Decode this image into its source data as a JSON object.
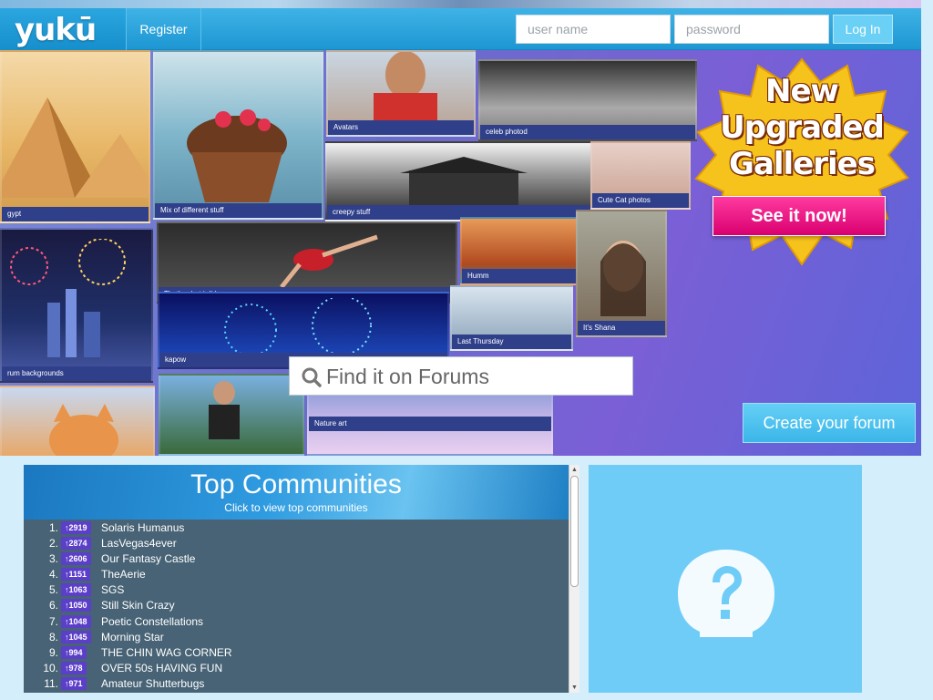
{
  "header": {
    "logo": "yukū",
    "register_label": "Register",
    "username_placeholder": "user name",
    "password_placeholder": "password",
    "login_label": "Log In"
  },
  "banner": {
    "tiles": [
      {
        "caption": "gypt"
      },
      {
        "caption": "Mix of different stuff"
      },
      {
        "caption": "Avatars"
      },
      {
        "caption": "celeb photod"
      },
      {
        "caption": "creepy stuff"
      },
      {
        "caption": "Cute Cat photos"
      },
      {
        "caption": "That's what i did"
      },
      {
        "caption": "Humm"
      },
      {
        "caption": "rum backgrounds"
      },
      {
        "caption": "kapow"
      },
      {
        "caption": "Last Thursday"
      },
      {
        "caption": "It's Shana"
      },
      {
        "caption": "Nature art"
      }
    ],
    "promo_line1": "New",
    "promo_line2": "Upgraded",
    "promo_line3": "Galleries",
    "promo_button": "See it now!",
    "search_placeholder": "Find it on Forums",
    "create_forum_label": "Create your forum"
  },
  "communities": {
    "title": "Top Communities",
    "subtitle": "Click to view top communities",
    "items": [
      {
        "rank": "1.",
        "count": "↑2919",
        "name": "Solaris Humanus"
      },
      {
        "rank": "2.",
        "count": "↑2874",
        "name": "LasVegas4ever"
      },
      {
        "rank": "3.",
        "count": "↑2606",
        "name": "Our Fantasy Castle"
      },
      {
        "rank": "4.",
        "count": "↑1151",
        "name": "TheAerie"
      },
      {
        "rank": "5.",
        "count": "↑1063",
        "name": "SGS"
      },
      {
        "rank": "6.",
        "count": "↑1050",
        "name": "Still Skin Crazy"
      },
      {
        "rank": "7.",
        "count": "↑1048",
        "name": "Poetic Constellations"
      },
      {
        "rank": "8.",
        "count": "↑1045",
        "name": "Morning Star"
      },
      {
        "rank": "9.",
        "count": "↑994",
        "name": "THE CHIN WAG CORNER"
      },
      {
        "rank": "10.",
        "count": "↑978",
        "name": "OVER 50s HAVING FUN"
      },
      {
        "rank": "11.",
        "count": "↑971",
        "name": "Amateur Shutterbugs"
      }
    ]
  },
  "colors": {
    "header_blue": "#1d96d2",
    "panel_bg": "#476375",
    "count_badge": "#5b3fc8",
    "promo_pink": "#d9006f",
    "help_panel": "#6fccf7"
  },
  "icons": {
    "search": "magnifier-icon",
    "help": "question-mark-icon",
    "edit": "edit-icon"
  }
}
